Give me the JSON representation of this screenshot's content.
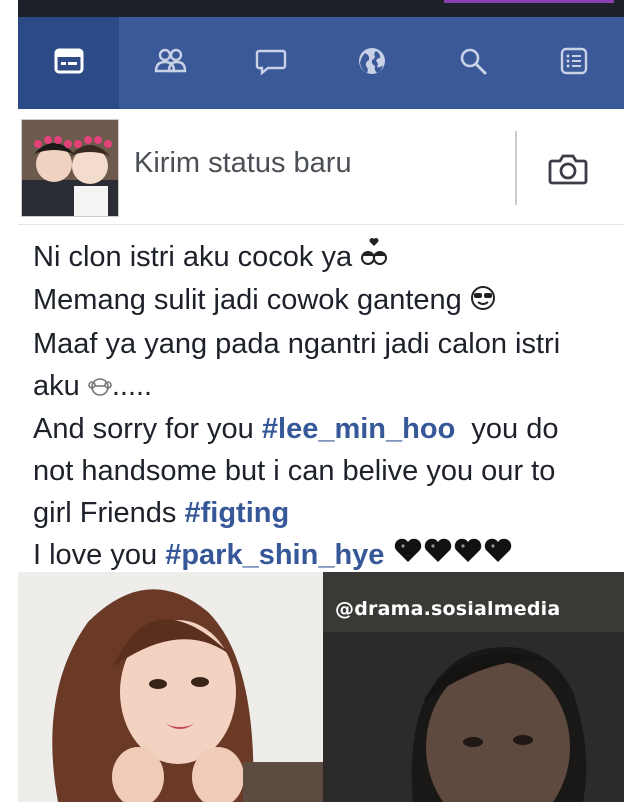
{
  "nav": {
    "tabs": [
      {
        "name": "news-feed",
        "icon": "news-feed-icon",
        "active": true
      },
      {
        "name": "friends",
        "icon": "friends-icon",
        "active": false
      },
      {
        "name": "messages",
        "icon": "chat-bubble-icon",
        "active": false
      },
      {
        "name": "notifications",
        "icon": "globe-icon",
        "active": false
      },
      {
        "name": "search",
        "icon": "search-icon",
        "active": false
      },
      {
        "name": "menu",
        "icon": "list-menu-icon",
        "active": false
      }
    ],
    "bar_color": "#3b5998",
    "active_color": "#2c4a86"
  },
  "composer": {
    "placeholder": "Kirim status baru",
    "camera_icon": "camera-icon"
  },
  "post": {
    "line1": "Ni clon istri aku cocok ya",
    "line2": "Memang sulit jadi cowok ganteng",
    "line3": "Maaf ya yang pada ngantri jadi calon istri",
    "line4_a": "aku",
    "line4_b": ".....",
    "line5_a": "And sorry for you",
    "line5_tag": "#lee_min_hoo",
    "line5_b": "  you do",
    "line6": "not handsome but i can belive you our to",
    "line7_a": "girl Friends",
    "line7_tag": "#figting",
    "line8_a": "I love you",
    "line8_tag": "#park_shin_hye",
    "hashtag_color": "#365899"
  },
  "photos": {
    "watermark": "@drama.sosialmedia"
  }
}
